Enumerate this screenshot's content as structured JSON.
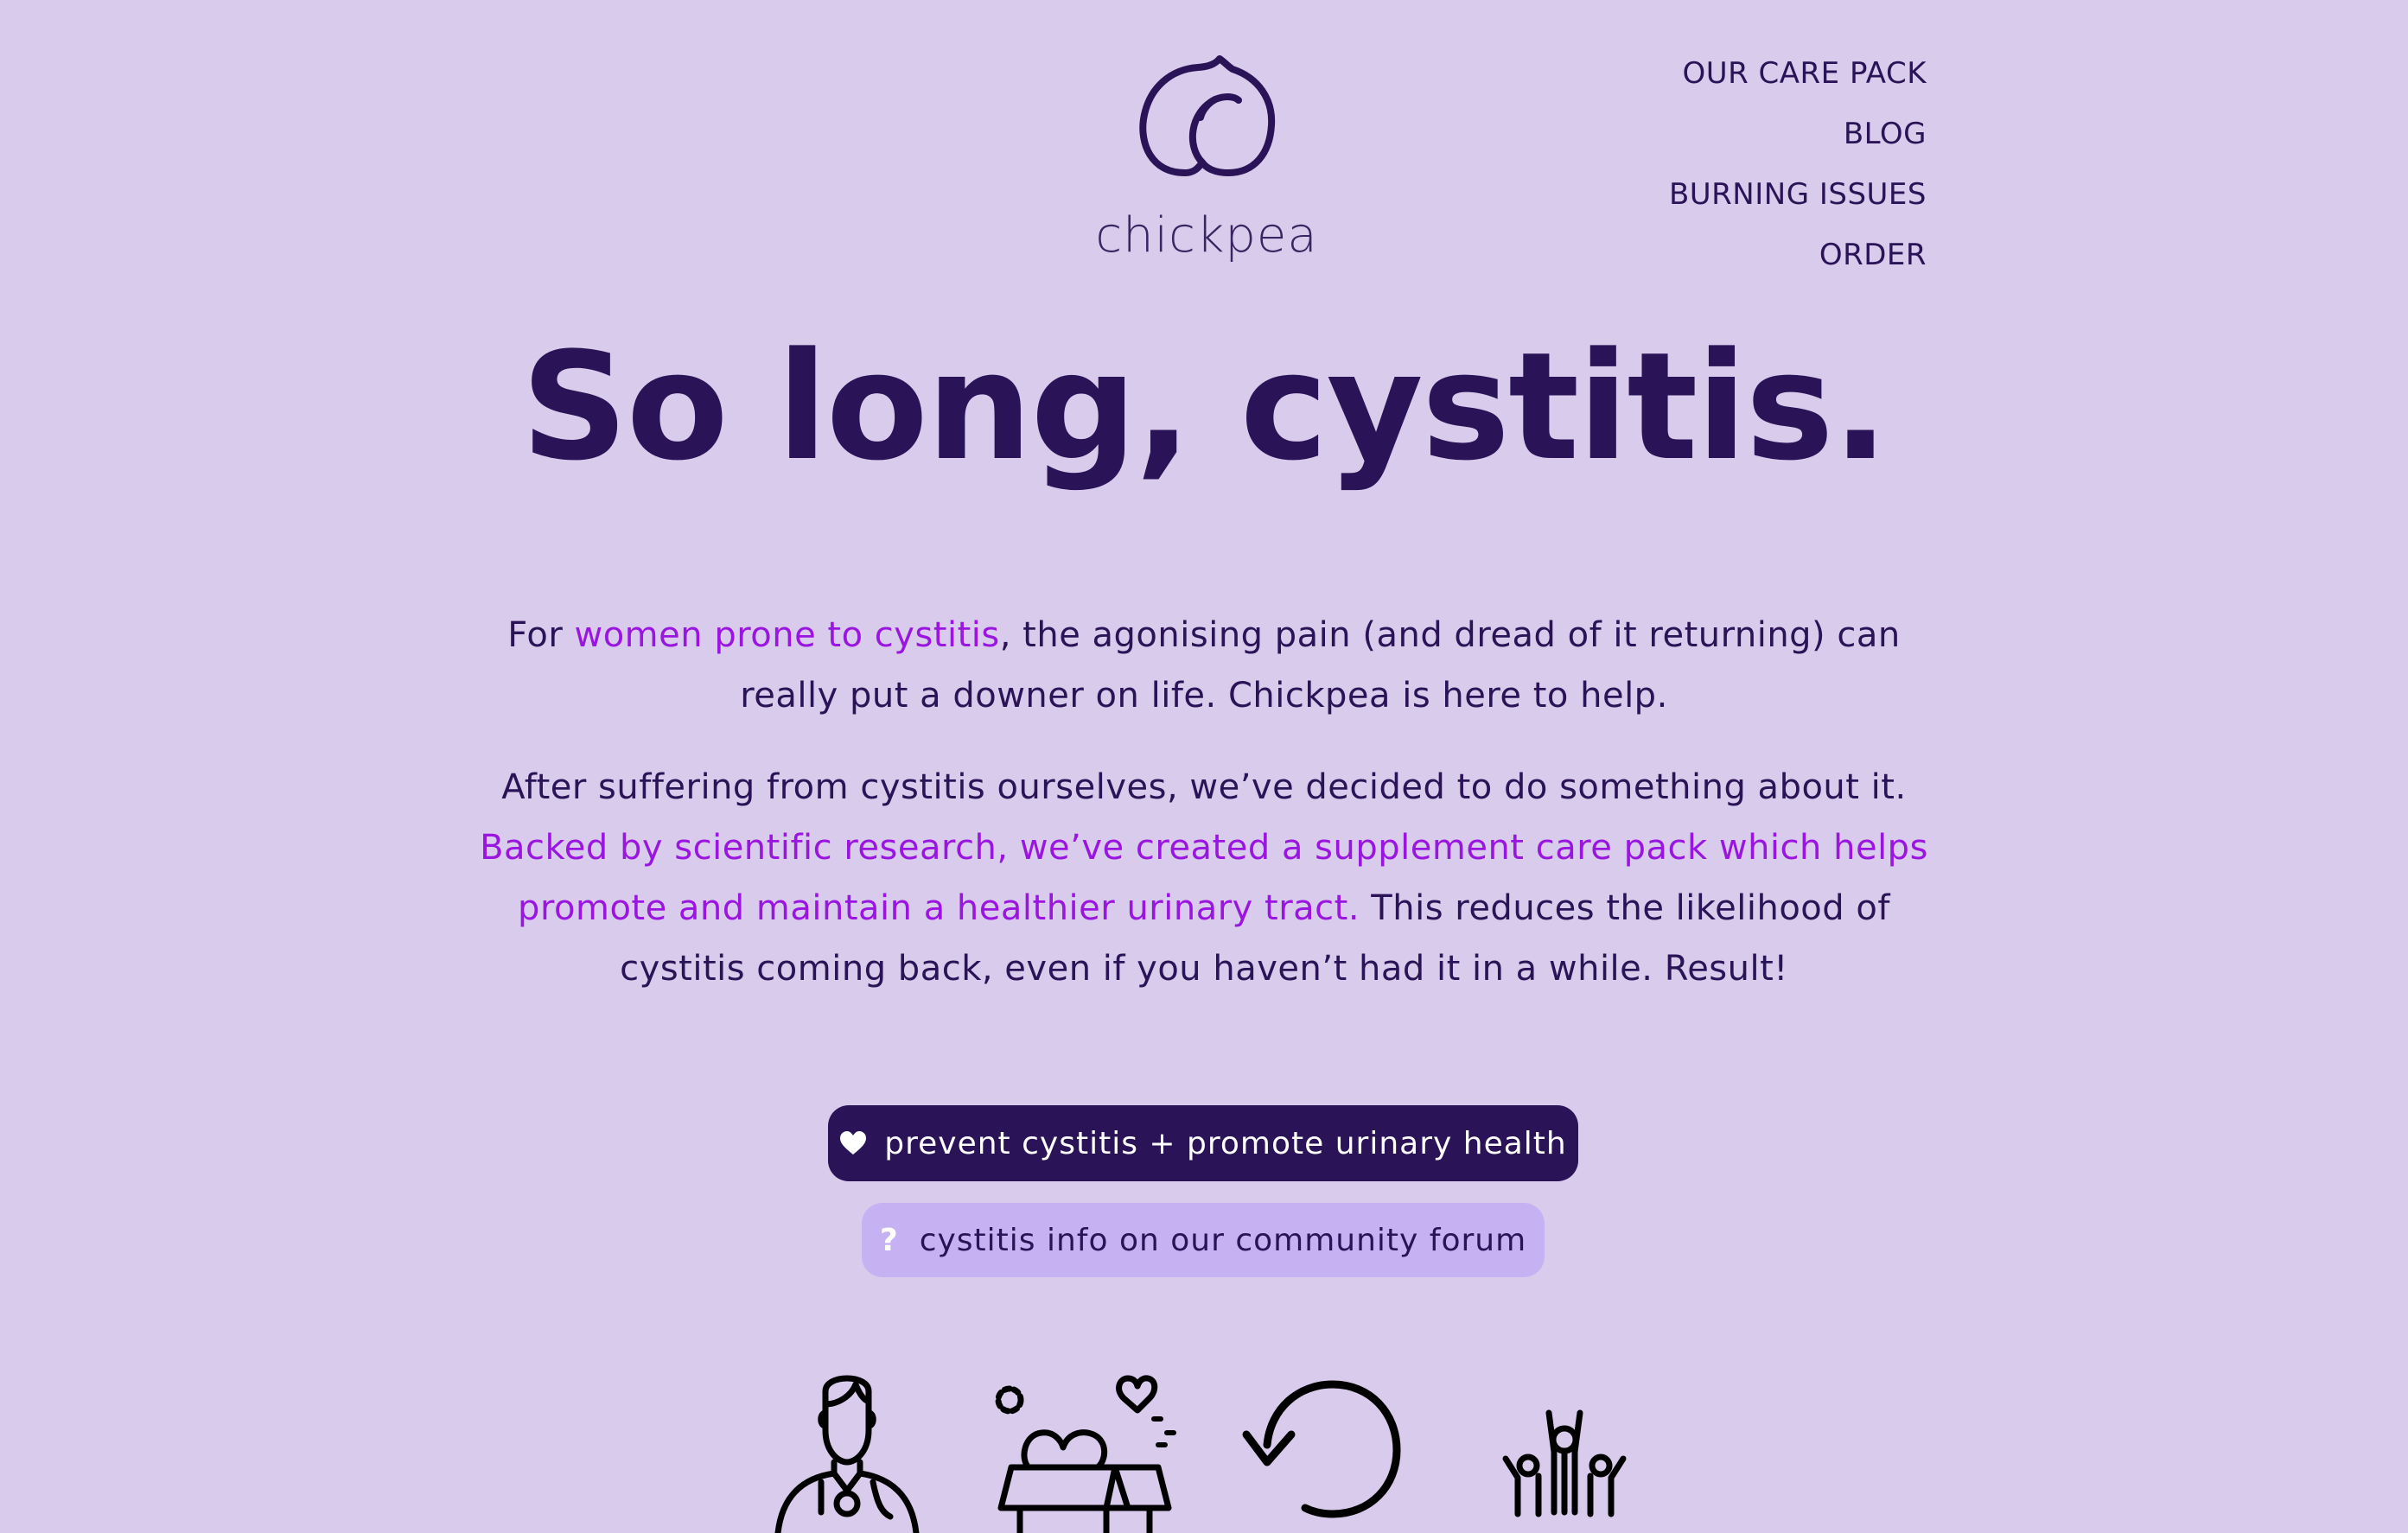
{
  "brand": {
    "name": "chickpea",
    "logo_icon": "chickpea-icon"
  },
  "nav": {
    "items": [
      {
        "label": "OUR CARE PACK"
      },
      {
        "label": "BLOG"
      },
      {
        "label": "BURNING ISSUES"
      },
      {
        "label": "ORDER"
      }
    ]
  },
  "hero": {
    "headline": "So long, cystitis."
  },
  "intro": {
    "p1_before": "For ",
    "p1_link": "women prone to cystitis",
    "p1_after": ", the agonising pain (and dread of it returning) can really put a downer on life. Chickpea is here to help.",
    "p2_before": "After suffering from cystitis ourselves, we’ve decided to do something about it. ",
    "p2_link": "Backed by scientific research, we’ve created a supplement care pack which helps promote and maintain a healthier urinary tract.",
    "p2_after": " This reduces the likelihood of cystitis coming back, even if you haven’t had it in a while. Result!"
  },
  "cta": {
    "primary_label": "prevent cystitis + promote urinary health",
    "primary_icon": "heart-icon",
    "secondary_label": "cystitis info on our community forum",
    "secondary_icon": "question-icon",
    "secondary_icon_glyph": "?"
  },
  "features": {
    "icons": [
      "doctor-icon",
      "care-package-icon",
      "refresh-icon",
      "community-icon"
    ]
  },
  "colors": {
    "background": "#d8cbeb",
    "primary": "#2a1356",
    "accent": "#9a16e0",
    "secondary_button": "#c6b1f2"
  }
}
